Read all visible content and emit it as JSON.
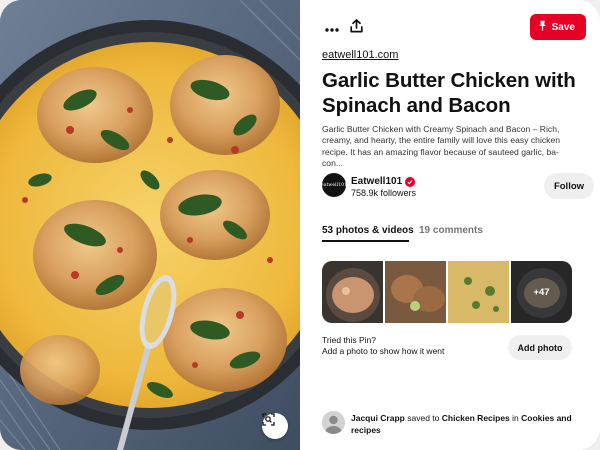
{
  "toolbar": {
    "more_icon": "more-dots-icon",
    "share_icon": "share-upload-icon",
    "save_label": "Save",
    "save_icon": "pushpin-icon"
  },
  "pin": {
    "source": "eatwell101.com",
    "title": "Garlic Butter Chicken with Spinach and Bacon",
    "description": "Garlic Butter Chicken with Creamy Spinach and Bacon – Rich, creamy, and hearty, the entire family will love this easy chicken recipe. It has an amazing flavor because of sauteed garlic, ba-con..."
  },
  "creator": {
    "avatar_text": "eatwell101",
    "name": "Eatwell101",
    "followers": "758.9k followers",
    "follow_label": "Follow"
  },
  "tabs": {
    "photos_label": "53 photos & videos",
    "comments_label": "19 comments"
  },
  "photos": {
    "more_label": "+47"
  },
  "tried": {
    "title": "Tried this Pin?",
    "subtitle": "Add a photo to show how it went",
    "add_label": "Add photo"
  },
  "saved_by": {
    "user": "Jacqui Crapp",
    "verb": "saved to",
    "board": "Chicken Recipes",
    "in_word": "in",
    "section": "Cookies and recipes"
  },
  "colors": {
    "accent": "#e60023",
    "button_gray": "#efefef",
    "muted_text": "#767676"
  },
  "image_panel": {
    "lens_icon": "visual-search-icon"
  }
}
